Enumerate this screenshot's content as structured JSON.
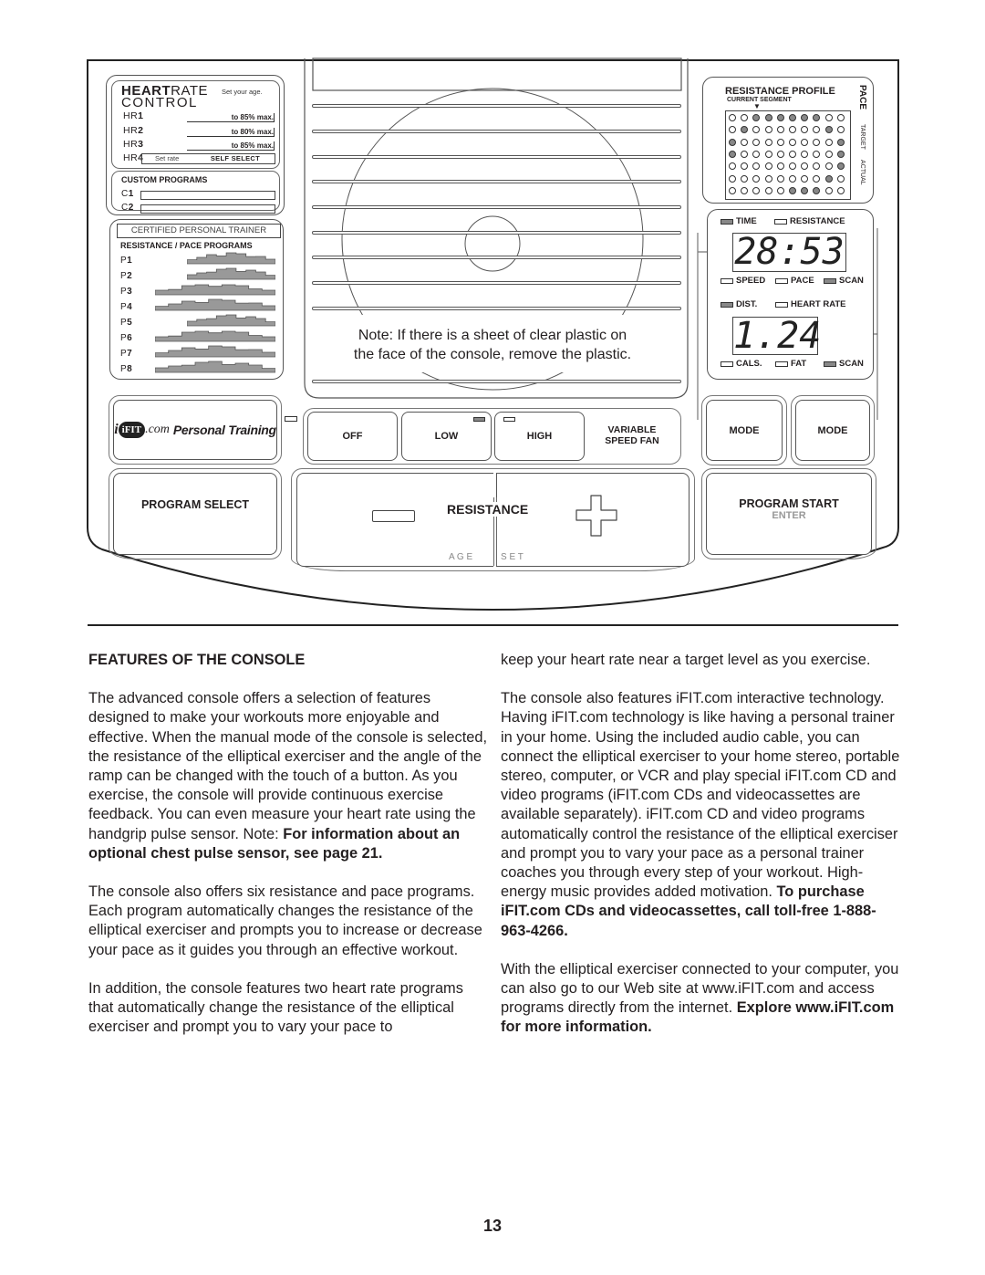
{
  "console": {
    "heart_rate_control": {
      "title_bold": "HEART",
      "title_light": "RATE",
      "title_line2": "CONTROL",
      "hint": "Set your age.",
      "rows": [
        {
          "label_light": "HR",
          "label_bold": "1",
          "target": "to 85% max."
        },
        {
          "label_light": "HR",
          "label_bold": "2",
          "target": "to 80% max."
        },
        {
          "label_light": "HR",
          "label_bold": "3",
          "target": "to 85% max."
        },
        {
          "label_light": "HR",
          "label_bold": "4",
          "set_rate": "Set rate",
          "target": "SELF SELECT"
        }
      ]
    },
    "custom_programs": {
      "title": "CUSTOM PROGRAMS",
      "rows": [
        {
          "label_light": "C",
          "label_bold": "1"
        },
        {
          "label_light": "C",
          "label_bold": "2"
        }
      ]
    },
    "trainer_programs": {
      "banner": "CERTIFIED PERSONAL TRAINER",
      "title": "RESISTANCE / PACE PROGRAMS",
      "programs": [
        {
          "label_light": "P",
          "label_bold": "1"
        },
        {
          "label_light": "P",
          "label_bold": "2"
        },
        {
          "label_light": "P",
          "label_bold": "3"
        },
        {
          "label_light": "P",
          "label_bold": "4"
        },
        {
          "label_light": "P",
          "label_bold": "5"
        },
        {
          "label_light": "P",
          "label_bold": "6"
        },
        {
          "label_light": "P",
          "label_bold": "7"
        },
        {
          "label_light": "P",
          "label_bold": "8"
        }
      ]
    },
    "center_note": {
      "line1": "Note: If there is a sheet of clear plastic on",
      "line2": "the face of the console, remove the plastic."
    },
    "resistance_profile": {
      "title": "RESISTANCE PROFILE",
      "subtitle": "CURRENT SEGMENT",
      "pace_label": "PACE",
      "target_label": "TARGET",
      "actual_label": "ACTUAL",
      "matrix": [
        [
          0,
          0,
          1,
          1,
          1,
          1,
          1,
          1,
          0,
          0
        ],
        [
          0,
          1,
          0,
          0,
          0,
          0,
          0,
          0,
          1,
          0
        ],
        [
          1,
          0,
          0,
          0,
          0,
          0,
          0,
          0,
          0,
          1
        ],
        [
          1,
          0,
          0,
          0,
          0,
          0,
          0,
          0,
          0,
          1
        ],
        [
          0,
          0,
          0,
          0,
          0,
          0,
          0,
          0,
          0,
          1
        ],
        [
          0,
          0,
          0,
          0,
          0,
          0,
          0,
          0,
          1,
          0
        ],
        [
          0,
          0,
          0,
          0,
          0,
          1,
          1,
          1,
          0,
          0
        ]
      ]
    },
    "display": {
      "upper_indicators": [
        {
          "label": "TIME",
          "on": true
        },
        {
          "label": "RESISTANCE",
          "on": false
        }
      ],
      "upper_value": "28:53",
      "upper_bottom_indicators": [
        {
          "label": "SPEED",
          "on": false
        },
        {
          "label": "PACE",
          "on": false
        },
        {
          "label": "SCAN",
          "on": true
        }
      ],
      "lower_indicators": [
        {
          "label": "DIST.",
          "on": true
        },
        {
          "label": "HEART RATE",
          "on": false
        }
      ],
      "lower_value": "1.24",
      "lower_bottom_indicators": [
        {
          "label": "CALS.",
          "on": false
        },
        {
          "label": "FAT",
          "on": false
        },
        {
          "label": "SCAN",
          "on": true
        }
      ]
    },
    "ifit_logo": {
      "brand": "iFIT",
      "suffix": ".com",
      "tagline": "Personal Training"
    },
    "fan": {
      "buttons": [
        {
          "label": "OFF",
          "led_on": null
        },
        {
          "label": "LOW",
          "led_on": true
        },
        {
          "label": "HIGH",
          "led_on": false
        }
      ],
      "title_line1": "VARIABLE",
      "title_line2": "SPEED FAN"
    },
    "mode_buttons": [
      "MODE",
      "MODE"
    ],
    "program_select": "PROGRAM SELECT",
    "resistance": {
      "label": "RESISTANCE",
      "age": "A G E",
      "set": "S E T"
    },
    "program_start": {
      "label": "PROGRAM START",
      "sub": "ENTER"
    }
  },
  "article": {
    "heading": "FEATURES OF THE CONSOLE",
    "left": {
      "p1_text": "The advanced console offers a selection of features designed to make your workouts more enjoyable and effective. When the manual mode of the console is selected, the resistance of the elliptical exerciser and the angle of the ramp can be changed with the touch of a button. As you exercise, the console will provide continuous exercise feedback. You can even measure your heart rate using the handgrip pulse sensor. Note: ",
      "p1_bold": "For information about an optional chest pulse sensor, see page 21.",
      "p2": "The console also offers six resistance and pace programs. Each program automatically changes the resistance of the elliptical exerciser and prompts you to increase or decrease your pace as it guides you through an effective workout.",
      "p3": "In addition, the console features two heart rate programs that automatically change the resistance of the elliptical exerciser and prompt you to vary your pace to"
    },
    "right": {
      "p0": "keep your heart rate near a target level as you exercise.",
      "p1_text": "The console also features iFIT.com interactive technology. Having iFIT.com technology is like having a personal trainer in your home. Using the included audio cable, you can connect the elliptical exerciser to your home stereo, portable stereo, computer, or VCR and play special iFIT.com CD and video programs (iFIT.com CDs and videocassettes are available separately). iFIT.com CD and video programs automatically control the resistance of the elliptical exerciser and prompt you to vary your pace as a personal trainer coaches you through every step of your workout. High-energy music provides added motivation. ",
      "p1_bold": "To purchase iFIT.com CDs and videocassettes, call toll-free 1-888-963-4266.",
      "p2_text": "With the elliptical exerciser connected to your computer, you can also go to our Web site at www.iFIT.com and access programs directly from the internet. ",
      "p2_bold": "Explore www.iFIT.com for more information."
    },
    "page_number": "13"
  }
}
